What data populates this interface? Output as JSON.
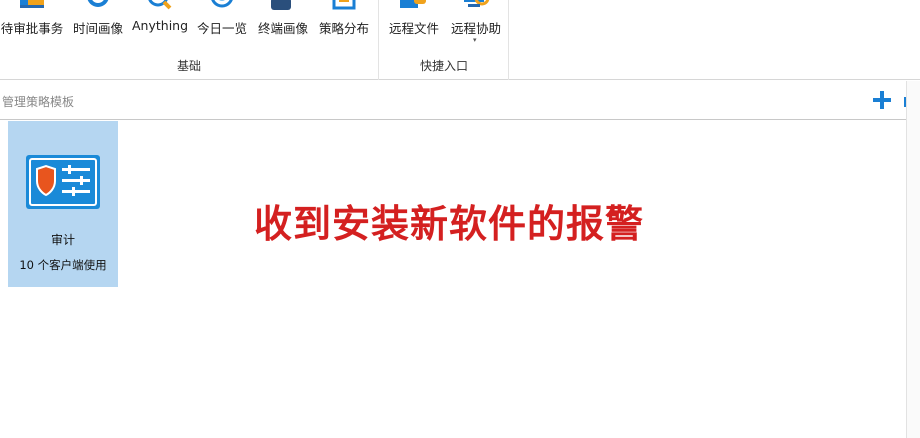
{
  "ribbon": {
    "groups": [
      {
        "label": "基础",
        "buttons": [
          {
            "label": "待审批事务",
            "icon": "approval-icon"
          },
          {
            "label": "时间画像",
            "icon": "clock-icon"
          },
          {
            "label": "Anything",
            "icon": "search-icon"
          },
          {
            "label": "今日一览",
            "icon": "overview-icon"
          },
          {
            "label": "终端画像",
            "icon": "user-icon"
          },
          {
            "label": "策略分布",
            "icon": "policy-icon"
          }
        ]
      },
      {
        "label": "快捷入口",
        "buttons": [
          {
            "label": "远程文件",
            "icon": "folder-icon"
          },
          {
            "label": "远程协助",
            "icon": "remote-assist-icon",
            "dropdown": "▾"
          }
        ]
      }
    ]
  },
  "template_bar": {
    "title": "管理策略模板",
    "add_icon": "plus-icon"
  },
  "cards": [
    {
      "name": "审计",
      "usage": "10 个客户端使用",
      "icon": "audit-policy-icon",
      "selected": true
    }
  ],
  "caption": "收到安装新软件的报警",
  "colors": {
    "accent": "#1a7fd4",
    "card_selected": "#b5d6f1",
    "caption": "#d42020",
    "shield": "#e8551e"
  }
}
